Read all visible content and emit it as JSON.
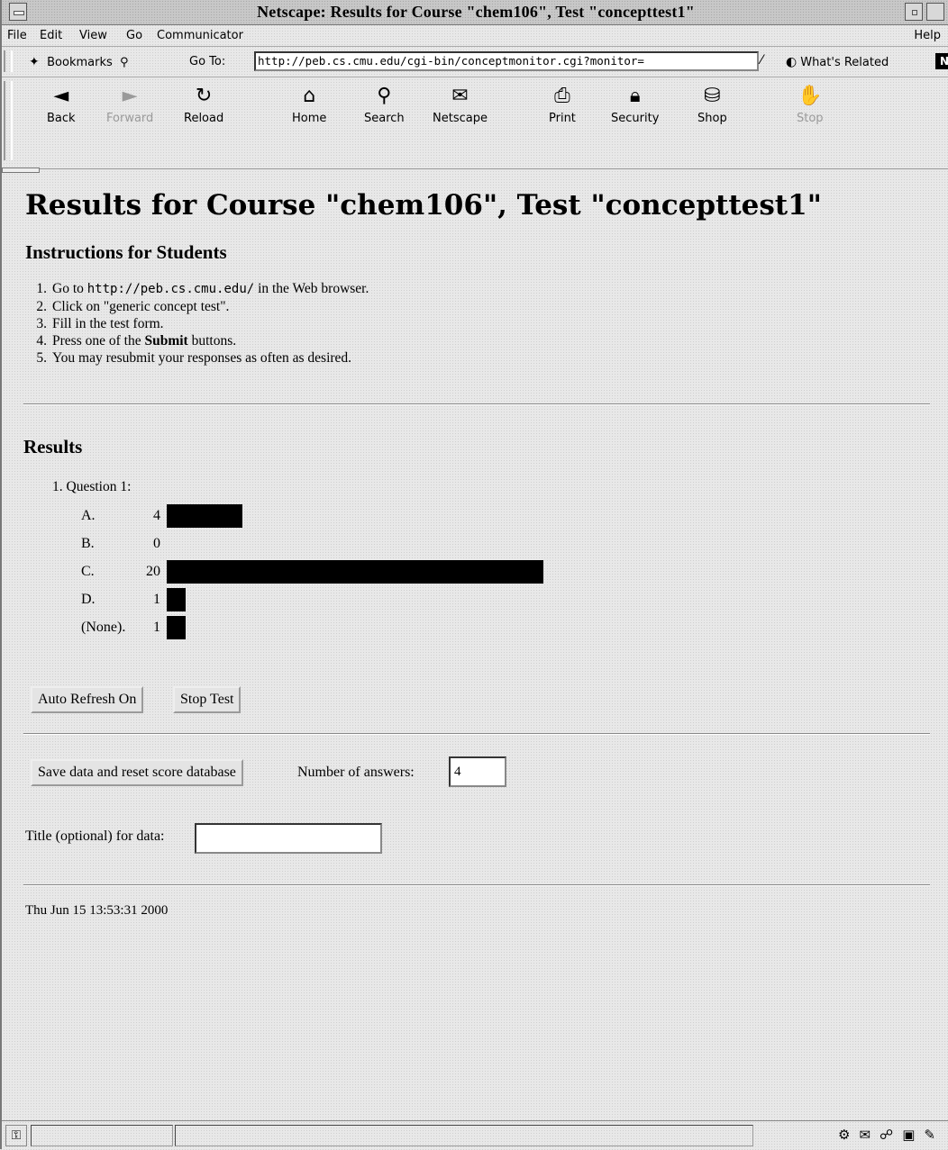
{
  "window": {
    "title": "Netscape: Results for Course \"chem106\", Test \"concepttest1\""
  },
  "menubar": {
    "items": [
      "File",
      "Edit",
      "View",
      "Go",
      "Communicator"
    ],
    "help": "Help"
  },
  "location": {
    "bookmarks_label": "Bookmarks",
    "goto_label": "Go To:",
    "url": "http://peb.cs.cmu.edu/cgi-bin/conceptmonitor.cgi?monitor=",
    "related_label": "What's Related"
  },
  "toolbar": {
    "back": "Back",
    "forward": "Forward",
    "reload": "Reload",
    "home": "Home",
    "search": "Search",
    "netscape": "Netscape",
    "print": "Print",
    "security": "Security",
    "shop": "Shop",
    "stop": "Stop"
  },
  "page": {
    "heading": "Results for Course \"chem106\", Test \"concepttest1\"",
    "instructions_heading": "Instructions for Students",
    "steps": [
      {
        "num": "1.",
        "pre": "Go to ",
        "code": "http://peb.cs.cmu.edu/",
        "post": " in the Web browser."
      },
      {
        "num": "2.",
        "pre": "Click on \"generic concept test\"."
      },
      {
        "num": "3.",
        "pre": "Fill in the test form."
      },
      {
        "num": "4.",
        "pre": "Press one of the ",
        "bold": "Submit",
        "post": " buttons."
      },
      {
        "num": "5.",
        "pre": "You may resubmit your responses as often as desired."
      }
    ],
    "results_heading": "Results",
    "question_label": "1. Question 1:",
    "answers": [
      {
        "option": "A.",
        "count": 4
      },
      {
        "option": "B.",
        "count": 0
      },
      {
        "option": "C.",
        "count": 20
      },
      {
        "option": "D.",
        "count": 1
      },
      {
        "option": "(None).",
        "count": 1
      }
    ],
    "auto_refresh_button": "Auto Refresh On",
    "stop_test_button": "Stop Test",
    "save_reset_button": "Save data and reset score database",
    "num_answers_label": "Number of answers:",
    "num_answers_value": "4",
    "title_label": "Title (optional) for data:",
    "title_value": "",
    "timestamp": "Thu Jun 15 13:53:31 2000"
  },
  "colors": {
    "bar": "#000000",
    "background": "#e8e8e8"
  }
}
